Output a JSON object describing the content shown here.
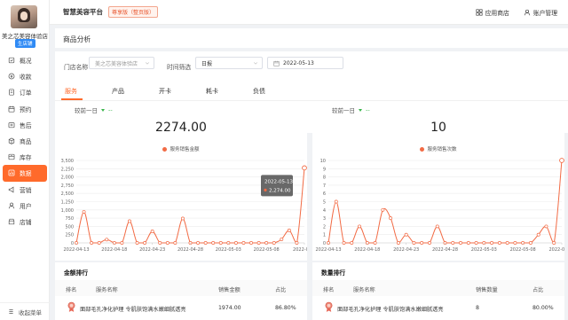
{
  "sidebar": {
    "store_name": "美之芯美容体验店",
    "store_badge": "生店铺",
    "items": [
      {
        "label": "概况",
        "icon": "overview-icon"
      },
      {
        "label": "收款",
        "icon": "payment-icon"
      },
      {
        "label": "订单",
        "icon": "order-icon"
      },
      {
        "label": "预约",
        "icon": "calendar-icon"
      },
      {
        "label": "售后",
        "icon": "after-sale-icon"
      },
      {
        "label": "商品",
        "icon": "product-icon"
      },
      {
        "label": "库存",
        "icon": "inventory-icon"
      },
      {
        "label": "数据",
        "icon": "data-icon",
        "active": true
      },
      {
        "label": "营销",
        "icon": "marketing-icon"
      },
      {
        "label": "用户",
        "icon": "user-icon"
      },
      {
        "label": "店铺",
        "icon": "store-icon"
      }
    ],
    "collapse_label": "收起菜单"
  },
  "topbar": {
    "platform": "智慧美容平台",
    "edition": "尊享版（整页版）",
    "app_store": "应用商店",
    "account": "账户管理"
  },
  "page": {
    "title": "商品分析"
  },
  "filters": {
    "store_label": "门店名称",
    "store_placeholder": "美之芯美容体验店",
    "time_label": "时间筛选",
    "time_value": "日报",
    "date_value": "2022-05-13"
  },
  "tabs": [
    {
      "label": "服务",
      "active": true
    },
    {
      "label": "产品"
    },
    {
      "label": "开卡"
    },
    {
      "label": "耗卡"
    },
    {
      "label": "负债"
    }
  ],
  "colors": {
    "accent": "#ff6a2b",
    "line": "#f26b45",
    "down": "#39b54a"
  },
  "left_panel": {
    "compare_label": "较前一日",
    "compare_value": "--",
    "big_value": "2274.00",
    "tooltip_date": "2022-05-13",
    "tooltip_value": "2,274.00",
    "rank_title": "金额排行",
    "rank_headers": [
      "排名",
      "服务名称",
      "销售金额",
      "占比"
    ],
    "rank_rows": [
      {
        "name": "面部毛孔净化护理 令肌肤饱满水嫩细腻透亮",
        "value": "1974.00",
        "percent": "86.80%"
      }
    ]
  },
  "right_panel": {
    "compare_label": "较前一日",
    "compare_value": "--",
    "big_value": "10",
    "rank_title": "数量排行",
    "rank_headers": [
      "排名",
      "服务名称",
      "销售数量",
      "占比"
    ],
    "rank_rows": [
      {
        "name": "面部毛孔净化护理 令肌肤饱满水嫩细腻透亮",
        "value": "8",
        "percent": "80.00%"
      }
    ]
  },
  "chart_data": [
    {
      "type": "line",
      "legend": "服务销售金额",
      "x_ticks": [
        "2022-04-13",
        "2022-04-18",
        "2022-04-23",
        "2022-04-28",
        "2022-05-03",
        "2022-05-08",
        "2022-05-1"
      ],
      "ylim": [
        0,
        2500
      ],
      "y_ticks": [
        0,
        250,
        500,
        750,
        1000,
        1250,
        1500,
        1750,
        2000,
        2250,
        2500
      ],
      "x": [
        "2022-04-13",
        "2022-04-14",
        "2022-04-15",
        "2022-04-16",
        "2022-04-17",
        "2022-04-18",
        "2022-04-19",
        "2022-04-20",
        "2022-04-21",
        "2022-04-22",
        "2022-04-23",
        "2022-04-24",
        "2022-04-25",
        "2022-04-26",
        "2022-04-27",
        "2022-04-28",
        "2022-04-29",
        "2022-04-30",
        "2022-05-01",
        "2022-05-02",
        "2022-05-03",
        "2022-05-04",
        "2022-05-05",
        "2022-05-06",
        "2022-05-07",
        "2022-05-08",
        "2022-05-09",
        "2022-05-10",
        "2022-05-11",
        "2022-05-12",
        "2022-05-13"
      ],
      "values": [
        0,
        940,
        0,
        0,
        100,
        0,
        0,
        660,
        0,
        0,
        350,
        0,
        0,
        0,
        740,
        0,
        0,
        0,
        0,
        0,
        0,
        0,
        0,
        0,
        0,
        0,
        0,
        110,
        380,
        0,
        2274
      ],
      "legend_position": "top-center",
      "grid": true
    },
    {
      "type": "line",
      "legend": "服务销售次数",
      "x_ticks": [
        "2022-04-13",
        "2022-04-18",
        "2022-04-23",
        "2022-04-28",
        "2022-05-03",
        "2022-05-08",
        "2022-05-13"
      ],
      "ylim": [
        0,
        10
      ],
      "y_ticks": [
        0,
        1,
        2,
        3,
        4,
        5,
        6,
        7,
        8,
        9,
        10
      ],
      "x": [
        "2022-04-13",
        "2022-04-14",
        "2022-04-15",
        "2022-04-16",
        "2022-04-17",
        "2022-04-18",
        "2022-04-19",
        "2022-04-20",
        "2022-04-21",
        "2022-04-22",
        "2022-04-23",
        "2022-04-24",
        "2022-04-25",
        "2022-04-26",
        "2022-04-27",
        "2022-04-28",
        "2022-04-29",
        "2022-04-30",
        "2022-05-01",
        "2022-05-02",
        "2022-05-03",
        "2022-05-04",
        "2022-05-05",
        "2022-05-06",
        "2022-05-07",
        "2022-05-08",
        "2022-05-09",
        "2022-05-10",
        "2022-05-11",
        "2022-05-12",
        "2022-05-13"
      ],
      "values": [
        0,
        5,
        0,
        0,
        2,
        0,
        0,
        4,
        3,
        0,
        1,
        0,
        0,
        0,
        2,
        0,
        0,
        0,
        0,
        0,
        0,
        0,
        0,
        0,
        0,
        0,
        0,
        1,
        2,
        0,
        10
      ],
      "legend_position": "top-center",
      "grid": true
    }
  ]
}
